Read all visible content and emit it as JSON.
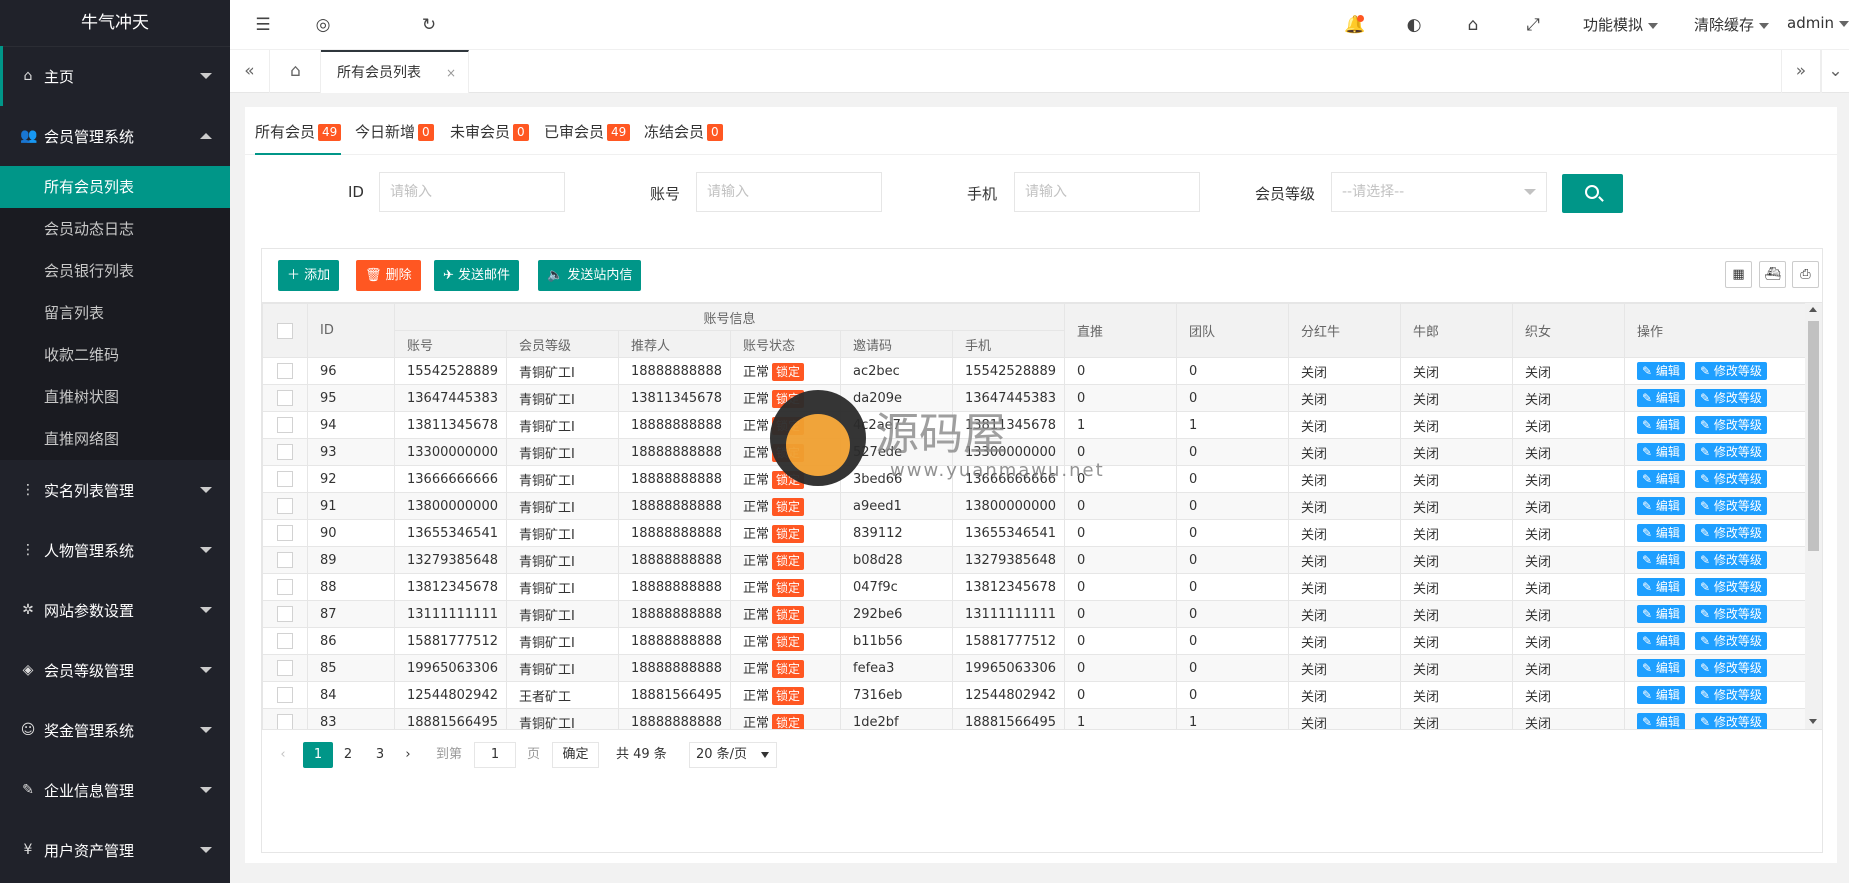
{
  "app": {
    "title": "牛气冲天"
  },
  "sidebar": {
    "items": [
      {
        "label": "主页",
        "icon": "home-icon",
        "glyph": "⌂"
      },
      {
        "label": "会员管理系统",
        "icon": "users-icon",
        "glyph": "👥",
        "open": true,
        "children": [
          "所有会员列表",
          "会员动态日志",
          "会员银行列表",
          "留言列表",
          "收款二维码",
          "直推树状图",
          "直推网络图"
        ]
      },
      {
        "label": "实名列表管理",
        "icon": "more-icon",
        "glyph": "⋮"
      },
      {
        "label": "人物管理系统",
        "icon": "more-icon",
        "glyph": "⋮"
      },
      {
        "label": "网站参数设置",
        "icon": "gear-icon",
        "glyph": "✲"
      },
      {
        "label": "会员等级管理",
        "icon": "diamond-icon",
        "glyph": "◈"
      },
      {
        "label": "奖金管理系统",
        "icon": "smile-icon",
        "glyph": "☺"
      },
      {
        "label": "企业信息管理",
        "icon": "edit-doc-icon",
        "glyph": "✎"
      },
      {
        "label": "用户资产管理",
        "icon": "yen-icon",
        "glyph": "¥"
      }
    ],
    "active_child": "所有会员列表"
  },
  "header": {
    "menus": [
      {
        "label": "功能模拟"
      },
      {
        "label": "清除缓存"
      },
      {
        "label": "admin"
      }
    ]
  },
  "tabs": {
    "active_label": "所有会员列表",
    "close": "×"
  },
  "member_tabs": [
    {
      "label": "所有会员",
      "count": "49"
    },
    {
      "label": "今日新增",
      "count": "0"
    },
    {
      "label": "未审会员",
      "count": "0"
    },
    {
      "label": "已审会员",
      "count": "49"
    },
    {
      "label": "冻结会员",
      "count": "0"
    }
  ],
  "search": {
    "id_label": "ID",
    "id_placeholder": "请输入",
    "account_label": "账号",
    "account_placeholder": "请输入",
    "phone_label": "手机",
    "phone_placeholder": "请输入",
    "level_label": "会员等级",
    "level_placeholder": "--请选择--"
  },
  "toolbar": {
    "add": "添加",
    "delete": "删除",
    "send_mail": "发送邮件",
    "send_msg": "发送站内信"
  },
  "table": {
    "group_header": "账号信息",
    "headers": {
      "id": "ID",
      "account": "账号",
      "level": "会员等级",
      "referrer": "推荐人",
      "status": "账号状态",
      "invite": "邀请码",
      "phone": "手机",
      "direct": "直推",
      "team": "团队",
      "fenhong": "分红牛",
      "niulang": "牛郎",
      "zhinv": "织女",
      "ops": "操作"
    },
    "lock_label": "锁定",
    "edit_label": "编辑",
    "level_edit_label": "修改等级",
    "rows": [
      {
        "id": "96",
        "account": "15542528889",
        "level": "青铜矿工I",
        "referrer": "18888888888",
        "status": "正常",
        "invite": "ac2bec",
        "phone": "15542528889",
        "direct": "0",
        "team": "0",
        "fenhong": "关闭",
        "niulang": "关闭",
        "zhinv": "关闭"
      },
      {
        "id": "95",
        "account": "13647445383",
        "level": "青铜矿工I",
        "referrer": "13811345678",
        "status": "正常",
        "invite": "da209e",
        "phone": "13647445383",
        "direct": "0",
        "team": "0",
        "fenhong": "关闭",
        "niulang": "关闭",
        "zhinv": "关闭"
      },
      {
        "id": "94",
        "account": "13811345678",
        "level": "青铜矿工I",
        "referrer": "18888888888",
        "status": "正常",
        "invite": "4c2ae7",
        "phone": "13811345678",
        "direct": "1",
        "team": "1",
        "fenhong": "关闭",
        "niulang": "关闭",
        "zhinv": "关闭"
      },
      {
        "id": "93",
        "account": "13300000000",
        "level": "青铜矿工I",
        "referrer": "18888888888",
        "status": "正常",
        "invite": "527ede",
        "phone": "13300000000",
        "direct": "0",
        "team": "0",
        "fenhong": "关闭",
        "niulang": "关闭",
        "zhinv": "关闭"
      },
      {
        "id": "92",
        "account": "13666666666",
        "level": "青铜矿工I",
        "referrer": "18888888888",
        "status": "正常",
        "invite": "3bed66",
        "phone": "13666666666",
        "direct": "0",
        "team": "0",
        "fenhong": "关闭",
        "niulang": "关闭",
        "zhinv": "关闭"
      },
      {
        "id": "91",
        "account": "13800000000",
        "level": "青铜矿工I",
        "referrer": "18888888888",
        "status": "正常",
        "invite": "a9eed1",
        "phone": "13800000000",
        "direct": "0",
        "team": "0",
        "fenhong": "关闭",
        "niulang": "关闭",
        "zhinv": "关闭"
      },
      {
        "id": "90",
        "account": "13655346541",
        "level": "青铜矿工I",
        "referrer": "18888888888",
        "status": "正常",
        "invite": "839112",
        "phone": "13655346541",
        "direct": "0",
        "team": "0",
        "fenhong": "关闭",
        "niulang": "关闭",
        "zhinv": "关闭"
      },
      {
        "id": "89",
        "account": "13279385648",
        "level": "青铜矿工I",
        "referrer": "18888888888",
        "status": "正常",
        "invite": "b08d28",
        "phone": "13279385648",
        "direct": "0",
        "team": "0",
        "fenhong": "关闭",
        "niulang": "关闭",
        "zhinv": "关闭"
      },
      {
        "id": "88",
        "account": "13812345678",
        "level": "青铜矿工I",
        "referrer": "18888888888",
        "status": "正常",
        "invite": "047f9c",
        "phone": "13812345678",
        "direct": "0",
        "team": "0",
        "fenhong": "关闭",
        "niulang": "关闭",
        "zhinv": "关闭"
      },
      {
        "id": "87",
        "account": "13111111111",
        "level": "青铜矿工I",
        "referrer": "18888888888",
        "status": "正常",
        "invite": "292be6",
        "phone": "13111111111",
        "direct": "0",
        "team": "0",
        "fenhong": "关闭",
        "niulang": "关闭",
        "zhinv": "关闭"
      },
      {
        "id": "86",
        "account": "15881777512",
        "level": "青铜矿工I",
        "referrer": "18888888888",
        "status": "正常",
        "invite": "b11b56",
        "phone": "15881777512",
        "direct": "0",
        "team": "0",
        "fenhong": "关闭",
        "niulang": "关闭",
        "zhinv": "关闭"
      },
      {
        "id": "85",
        "account": "19965063306",
        "level": "青铜矿工I",
        "referrer": "18888888888",
        "status": "正常",
        "invite": "fefea3",
        "phone": "19965063306",
        "direct": "0",
        "team": "0",
        "fenhong": "关闭",
        "niulang": "关闭",
        "zhinv": "关闭"
      },
      {
        "id": "84",
        "account": "12544802942",
        "level": "王者矿工",
        "referrer": "18881566495",
        "status": "正常",
        "invite": "7316eb",
        "phone": "12544802942",
        "direct": "0",
        "team": "0",
        "fenhong": "关闭",
        "niulang": "关闭",
        "zhinv": "关闭"
      },
      {
        "id": "83",
        "account": "18881566495",
        "level": "青铜矿工I",
        "referrer": "18888888888",
        "status": "正常",
        "invite": "1de2bf",
        "phone": "18881566495",
        "direct": "1",
        "team": "1",
        "fenhong": "关闭",
        "niulang": "关闭",
        "zhinv": "关闭"
      }
    ]
  },
  "pager": {
    "pages": [
      "1",
      "2",
      "3"
    ],
    "current": "1",
    "goto_label": "到第",
    "goto_value": "1",
    "page_unit": "页",
    "confirm": "确定",
    "total": "共 49 条",
    "size": "20 条/页"
  },
  "watermark": {
    "title": "源码屋",
    "url": "www.yuanmawu.net"
  },
  "colors": {
    "primary": "#009688",
    "danger": "#ff5722",
    "info": "#1e9fff",
    "sidebar": "#20222a"
  }
}
